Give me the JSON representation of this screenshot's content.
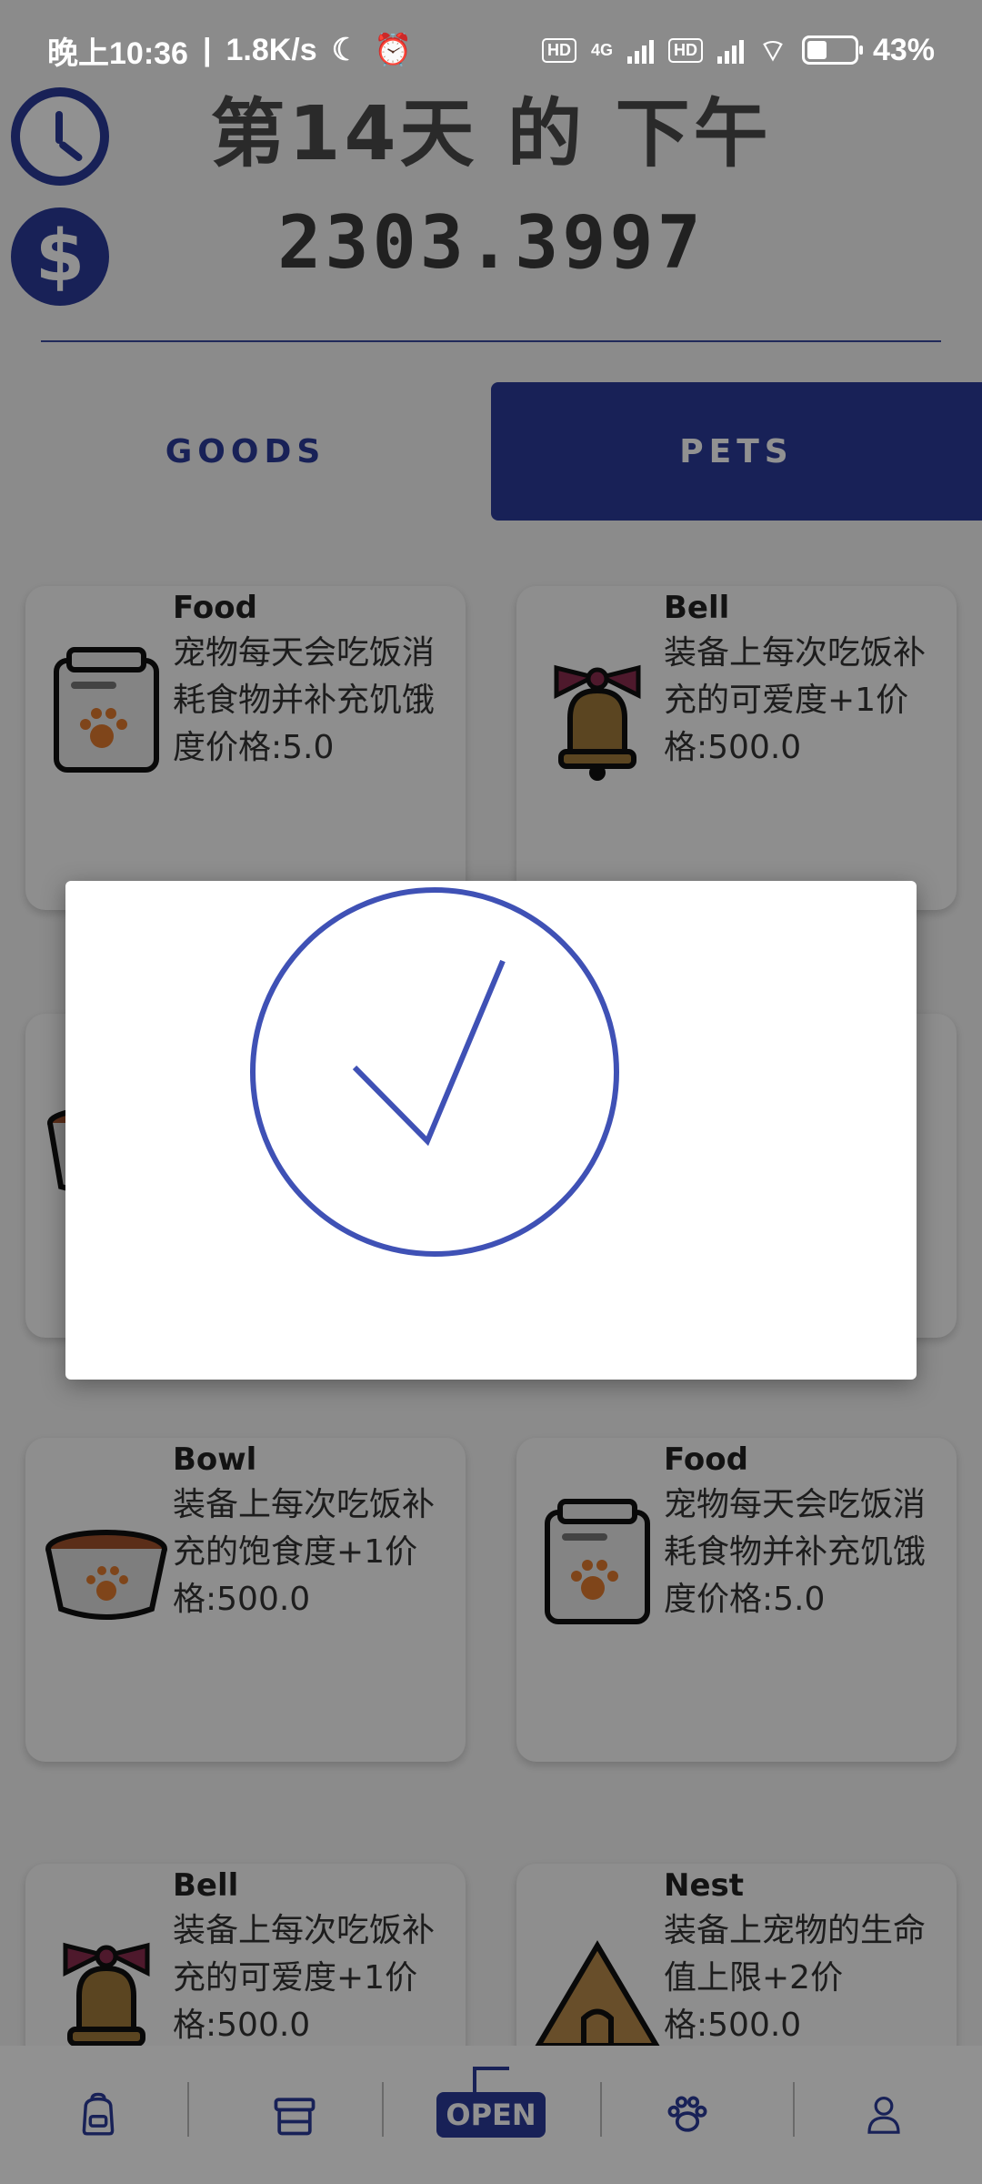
{
  "status_bar": {
    "time": "晚上10:36",
    "speed": "1.8K/s",
    "battery": "43%",
    "battery_level": 0.43,
    "network_label": "4G"
  },
  "header": {
    "day_text": "第14天 的 下午",
    "money": "2303.3997"
  },
  "tabs": {
    "goods": "GOODS",
    "pets": "PETS",
    "active": "pets"
  },
  "items": [
    {
      "name": "Food",
      "desc": "宠物每天会吃饭消耗食物并补充饥饿度价格:5.0",
      "icon": "food-bag-icon"
    },
    {
      "name": "Bell",
      "desc": "装备上每次吃饭补充的可爱度+1价格:500.0",
      "icon": "bell-icon"
    },
    {
      "name": "Bowl",
      "desc": "装备上每次吃饭补充的饱食度+1价格:500.0",
      "icon": "bowl-icon"
    },
    {
      "name": "Food",
      "desc": "宠物每天会吃饭消耗食物并补充饥饿度价格:5.0",
      "icon": "food-bag-icon"
    },
    {
      "name": "Bell",
      "desc": "装备上每次吃饭补充的可爱度+1价格:500.0",
      "icon": "bell-icon"
    },
    {
      "name": "Nest",
      "desc": "装备上宠物的生命值上限+2价格:500.0",
      "icon": "nest-tent-icon"
    }
  ],
  "dialog": {
    "icon": "success-check-icon"
  },
  "bottom_nav": {
    "items": [
      "backpack-icon",
      "store-icon",
      "open-sign-icon",
      "paw-icon",
      "user-icon"
    ],
    "open_label": "OPEN"
  },
  "colors": {
    "accent": "#2b3b9a",
    "check": "#3f51b5"
  }
}
